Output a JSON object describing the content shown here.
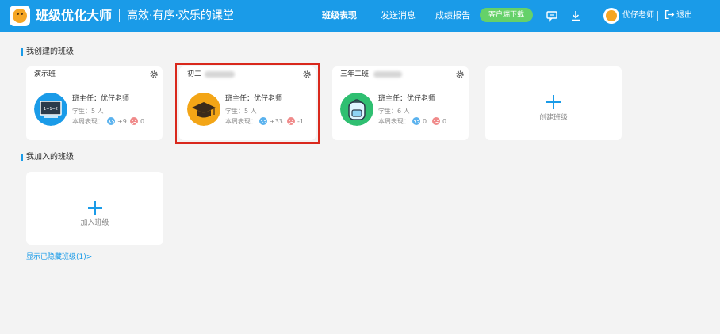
{
  "header": {
    "brand": "班级优化大师",
    "slogan": "高效·有序·欢乐的课堂",
    "nav": [
      "班级表现",
      "发送消息",
      "成绩报告"
    ],
    "download_label": "客户端下载",
    "user_name": "优仔老师",
    "logout_label": "退出"
  },
  "created": {
    "title": "我创建的班级",
    "classes": [
      {
        "name": "演示班",
        "teacher": "班主任：优仔老师",
        "students": "学生：5 人",
        "perf_label": "本周表现：",
        "positive": "+9",
        "negative": "0",
        "icon": "blackboard-icon",
        "icon_color": "#1a9be8"
      },
      {
        "name": "初二",
        "teacher": "班主任：优仔老师",
        "students": "学生：5 人",
        "perf_label": "本周表现：",
        "positive": "+33",
        "negative": "-1",
        "icon": "graduation-cap-icon",
        "icon_color": "#f3a516"
      },
      {
        "name": "三年二班",
        "teacher": "班主任：优仔老师",
        "students": "学生：6 人",
        "perf_label": "本周表现：",
        "positive": "0",
        "negative": "0",
        "icon": "backpack-icon",
        "icon_color": "#2fbf71"
      }
    ],
    "create_label": "创建班级"
  },
  "joined": {
    "title": "我加入的班级",
    "join_label": "加入班级"
  },
  "hidden_link": "显示已隐藏班级(1)>",
  "colors": {
    "primary": "#1a9be8",
    "download": "#65d169",
    "highlight": "#d9281c",
    "positive": "#5ab2ee",
    "negative": "#f08a8a"
  }
}
